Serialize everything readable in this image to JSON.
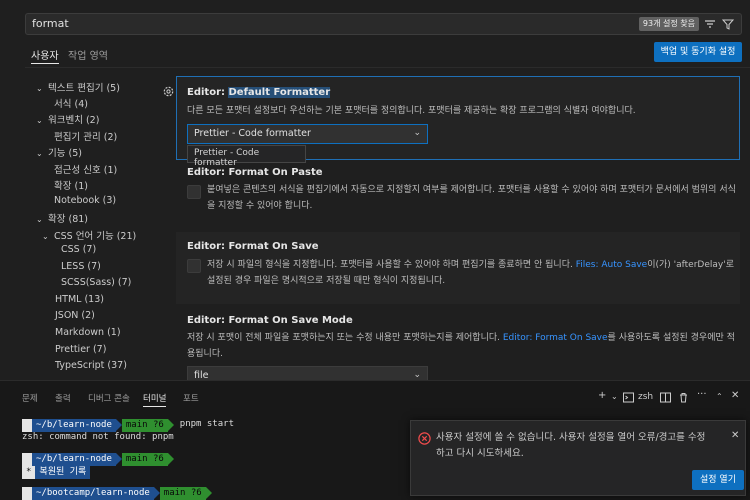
{
  "search": {
    "query": "format",
    "result_count": "93개 설정 찾음"
  },
  "tabs": [
    {
      "label": "사용자"
    },
    {
      "label": "작업 영역"
    }
  ],
  "backup_button": "백업 및 동기화 설정",
  "tree": [
    {
      "label": "텍스트 편집기 (5)",
      "expanded": true
    },
    {
      "label": "서식 (4)"
    },
    {
      "label": "워크벤치 (2)",
      "expanded": true
    },
    {
      "label": "편집기 관리 (2)"
    },
    {
      "label": "기능 (5)",
      "expanded": true
    },
    {
      "label": "접근성 신호 (1)"
    },
    {
      "label": "확장 (1)"
    },
    {
      "label": "Notebook (3)"
    },
    {
      "label": "확장 (81)",
      "expanded": true
    },
    {
      "label": "CSS 언어 기능 (21)",
      "expanded": true
    },
    {
      "label": "CSS (7)"
    },
    {
      "label": "LESS (7)"
    },
    {
      "label": "SCSS(Sass) (7)"
    },
    {
      "label": "HTML (13)"
    },
    {
      "label": "JSON (2)"
    },
    {
      "label": "Markdown (1)"
    },
    {
      "label": "Prettier (7)"
    },
    {
      "label": "TypeScript (37)"
    }
  ],
  "settings": {
    "default_formatter": {
      "prefix": "Editor: ",
      "name": "Default Formatter",
      "desc": "다른 모든 포맷터 설정보다 우선하는 기본 포맷터를 정의합니다. 포맷터를 제공하는 확장 프로그램의 식별자 여야합니다.",
      "value": "Prettier - Code formatter",
      "tooltip": "Prettier - Code formatter"
    },
    "format_on_paste": {
      "prefix": "Editor: ",
      "name": "Format On Paste",
      "desc": "붙여넣은 콘텐츠의 서식을 편집기에서 자동으로 지정할지 여부를 제어합니다. 포맷터를 사용할 수 있어야 하며 포맷터가 문서에서 범위의 서식을 지정할 수 있어야 합니다."
    },
    "format_on_save": {
      "prefix": "Editor: ",
      "name": "Format On Save",
      "desc_a": "저장 시 파일의 형식을 지정합니다. 포맷터를 사용할 수 있어야 하며 편집기를 종료하면 안 됩니다. ",
      "link": "Files: Auto Save",
      "desc_b": "이(가) 'afterDelay'로 설정된 경우 파일은 명시적으로 저장될 때만 형식이 지정됩니다."
    },
    "format_on_save_mode": {
      "prefix": "Editor: ",
      "name": "Format On Save Mode",
      "desc_a": "저장 시 포맷이 전체 파일을 포맷하는지 또는 수정 내용만 포맷하는지를 제어합니다. ",
      "link": "Editor: Format On Save",
      "desc_b": "를 사용하도록 설정된 경우에만 적용됩니다.",
      "value": "file"
    }
  },
  "panel": {
    "tabs": [
      "문제",
      "출력",
      "디버그 콘솔",
      "터미널",
      "포트"
    ],
    "active_tab": "터미널",
    "shell": "zsh"
  },
  "terminal": {
    "line1_dir": "~/b/learn-node",
    "line1_git": "main ?6",
    "line1_cmd": "pnpm start",
    "line2": "zsh: command not found: pnpm",
    "line3_dir": "~/b/learn-node",
    "line3_git": "main ?6",
    "line4_mark": "*",
    "line4_text": "복원된 기록",
    "line5_dir": "~/bootcamp/learn-node",
    "line5_git": "main ?6"
  },
  "notification": {
    "message": "사용자 설정에 쓸 수 없습니다. 사용자 설정을 열어 오류/경고를 수정하고 다시 시도하세요.",
    "button": "설정 열기"
  },
  "colors": {
    "accent": "#0e70c0",
    "link": "#3794ff",
    "error": "#f14c4c",
    "git_green": "#2f8f2f",
    "dir_blue": "#1f4f8f"
  }
}
